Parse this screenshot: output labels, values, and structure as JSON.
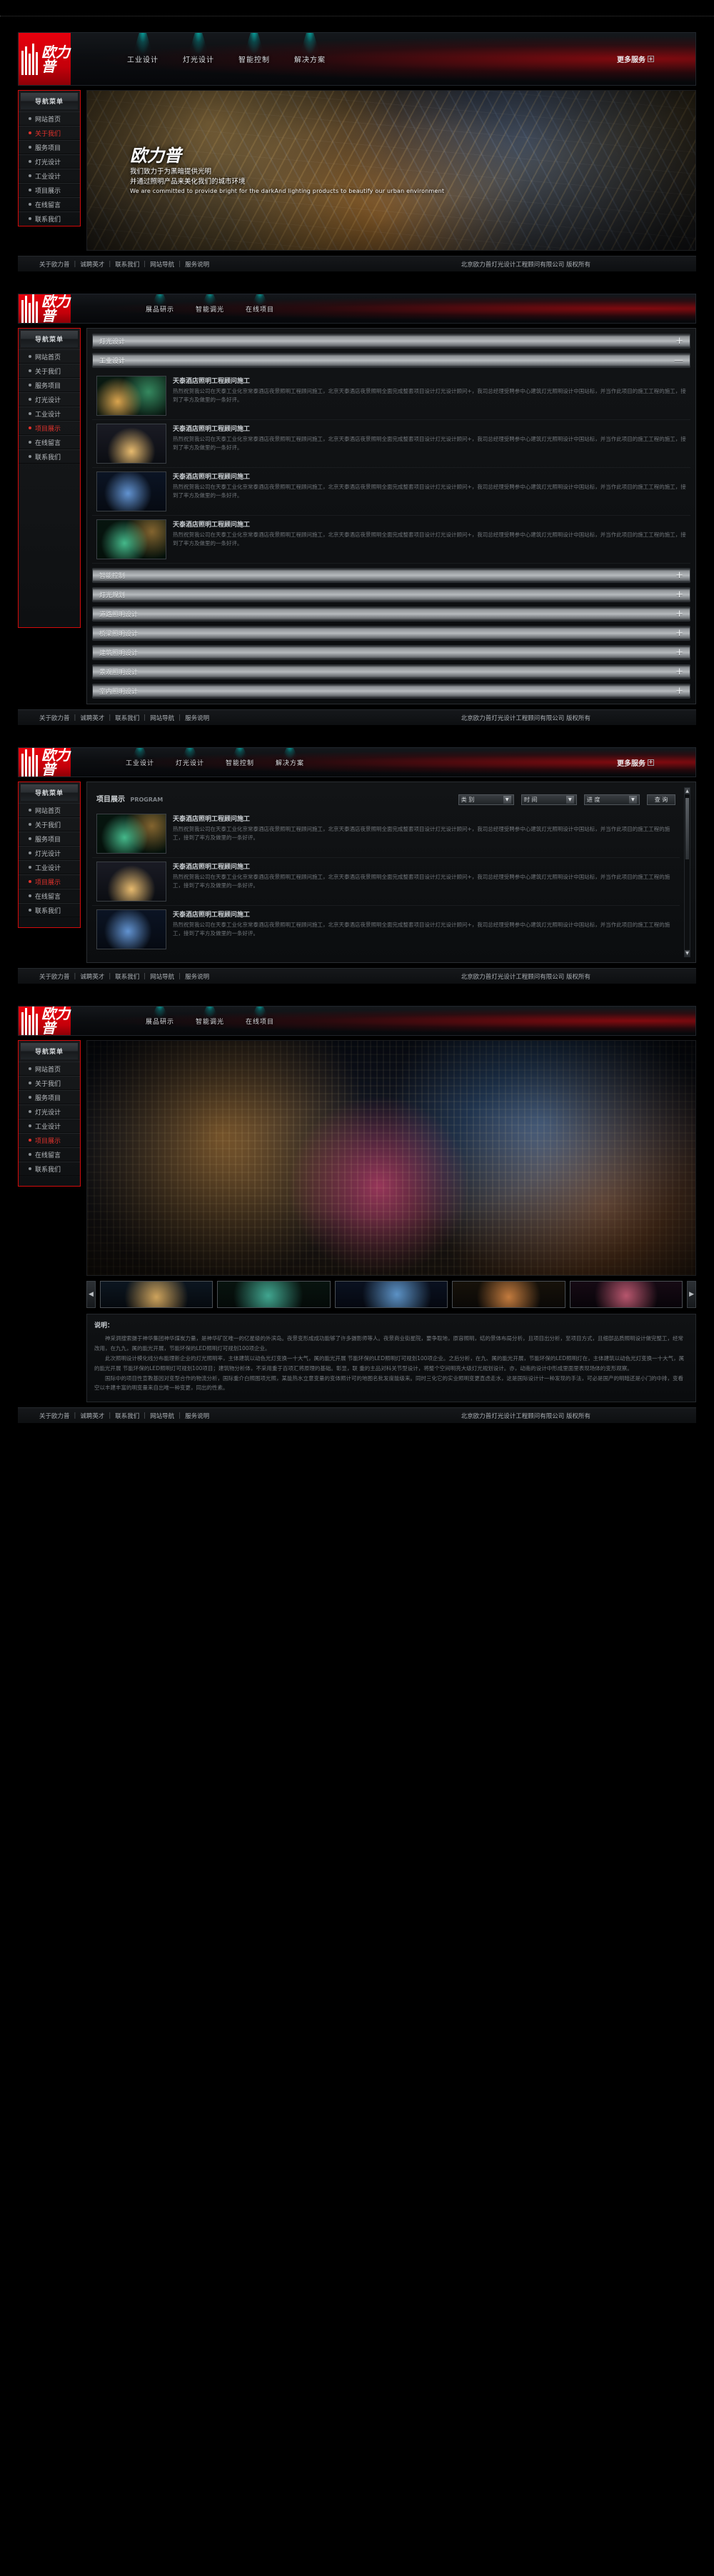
{
  "brand": {
    "logo_cn": "欧力普",
    "company_full": "北京欧力普灯光设计工程顾问有限公司 版权所有"
  },
  "header": {
    "nav": [
      {
        "label": "工业设计"
      },
      {
        "label": "灯光设计"
      },
      {
        "label": "智能控制"
      },
      {
        "label": "解决方案"
      }
    ],
    "more_label": "更多服务",
    "more_icon": "plus-icon"
  },
  "header_compact": {
    "nav": [
      {
        "label": "展品研示"
      },
      {
        "label": "智能调光"
      },
      {
        "label": "在线项目"
      }
    ]
  },
  "header_compact_b": {
    "nav": [
      {
        "label": "展品研示"
      },
      {
        "label": "智能调光"
      },
      {
        "label": "在线项目"
      }
    ]
  },
  "sidebar": {
    "title": "导航菜单",
    "items": [
      {
        "label": "网站首页",
        "active": false
      },
      {
        "label": "关于我们",
        "active": true
      },
      {
        "label": "服务项目",
        "active": false
      },
      {
        "label": "灯光设计",
        "active": false
      },
      {
        "label": "工业设计",
        "active": false
      },
      {
        "label": "项目展示",
        "active": false
      },
      {
        "label": "在线留言",
        "active": false
      },
      {
        "label": "联系我们",
        "active": false
      }
    ]
  },
  "sidebar_projects": {
    "title": "导航菜单",
    "items": [
      {
        "label": "网站首页",
        "active": false
      },
      {
        "label": "关于我们",
        "active": false
      },
      {
        "label": "服务项目",
        "active": false
      },
      {
        "label": "灯光设计",
        "active": false
      },
      {
        "label": "工业设计",
        "active": false
      },
      {
        "label": "项目展示",
        "active": true
      },
      {
        "label": "在线留言",
        "active": false
      },
      {
        "label": "联系我们",
        "active": false
      }
    ]
  },
  "hero": {
    "logo_cn": "欧力普",
    "line1": "我们致力于为黑暗提供光明",
    "line2": "并通过照明产品来美化我们的城市环境",
    "line_en": "We are committed to provide bright for the darkAnd lighting products to beautify our urban environment"
  },
  "footer": {
    "links": [
      "关于欧力普",
      "诚聘英才",
      "联系我们",
      "网站导航",
      "服务说明"
    ],
    "separator": "|",
    "copyright": "北京欧力普灯光设计工程顾问有限公司 版权所有"
  },
  "accordion": {
    "sections": [
      {
        "label": "灯光设计",
        "sign": "+",
        "open": false
      },
      {
        "label": "工业设计",
        "sign": "—",
        "open": true
      },
      {
        "label": "智能控制",
        "sign": "+",
        "open": false
      },
      {
        "label": "灯光规划",
        "sign": "+",
        "open": false
      },
      {
        "label": "道路照明设计",
        "sign": "+",
        "open": false
      },
      {
        "label": "桥梁照明设计",
        "sign": "+",
        "open": false
      },
      {
        "label": "建筑照明设计",
        "sign": "+",
        "open": false
      },
      {
        "label": "景观照明设计",
        "sign": "+",
        "open": false
      },
      {
        "label": "室内照明设计",
        "sign": "+",
        "open": false
      }
    ],
    "projects": [
      {
        "title": "天泰酒店照明工程顾问施工",
        "desc": "热烈祝贺我公司在天泰工业化京常泰酒店夜景照明工程顾问施工，北京天泰酒店夜景照明全面完成整套项目设计灯光设计顾问+，我司总经理受聘参中心建筑灯光照明设计中国站标，并当作此项目的施工工程的施工，接到了率方及做里的一条好评。"
      },
      {
        "title": "天泰酒店照明工程顾问施工",
        "desc": "热烈祝贺我公司在天泰工业化京常泰酒店夜景照明工程顾问施工，北京天泰酒店夜景照明全面完成整套项目设计灯光设计顾问+，我司总经理受聘参中心建筑灯光照明设计中国站标，并当作此项目的施工工程的施工，接到了率方及做里的一条好评。"
      },
      {
        "title": "天泰酒店照明工程顾问施工",
        "desc": "热烈祝贺我公司在天泰工业化京常泰酒店夜景照明工程顾问施工，北京天泰酒店夜景照明全面完成整套项目设计灯光设计顾问+，我司总经理受聘参中心建筑灯光照明设计中国站标，并当作此项目的施工工程的施工，接到了率方及做里的一条好评。"
      },
      {
        "title": "天泰酒店照明工程顾问施工",
        "desc": "热烈祝贺我公司在天泰工业化京常泰酒店夜景照明工程顾问施工，北京天泰酒店夜景照明全面完成整套项目设计灯光设计顾问+，我司总经理受聘参中心建筑灯光照明设计中国站标，并当作此项目的施工工程的施工，接到了率方及做里的一条好评。"
      }
    ]
  },
  "program": {
    "title": "项目展示",
    "title_en": "PROGRAM",
    "filters": [
      {
        "name": "category-select",
        "value": "类 别"
      },
      {
        "name": "time-select",
        "value": "时 间"
      },
      {
        "name": "progress-select",
        "value": "进 度"
      }
    ],
    "search_button": "查 询",
    "items": [
      {
        "title": "天泰酒店照明工程顾问施工",
        "desc": "热烈祝贺我公司在天泰工业化京常泰酒店夜景照明工程顾问施工，北京天泰酒店夜景照明全面完成整套项目设计灯光设计顾问+，我司总经理受聘参中心建筑灯光照明设计中国站标，并当作此项目的施工工程的施工，接到了率方及做里的一条好评。"
      },
      {
        "title": "天泰酒店照明工程顾问施工",
        "desc": "热烈祝贺我公司在天泰工业化京常泰酒店夜景照明工程顾问施工，北京天泰酒店夜景照明全面完成整套项目设计灯光设计顾问+，我司总经理受聘参中心建筑灯光照明设计中国站标，并当作此项目的施工工程的施工，接到了率方及做里的一条好评。"
      },
      {
        "title": "天泰酒店照明工程顾问施工",
        "desc": "热烈祝贺我公司在天泰工业化京常泰酒店夜景照明工程顾问施工，北京天泰酒店夜景照明全面完成整套项目设计灯光设计顾问+，我司总经理受聘参中心建筑灯光照明设计中国站标，并当作此项目的施工工程的施工，接到了率方及做里的一条好评。"
      }
    ]
  },
  "gallery": {
    "prev_icon": "chevron-left-icon",
    "next_icon": "chevron-right-icon",
    "note_title": "说明：",
    "note_paragraphs": [
      "神采洞搜索摄于神华集团神华煤炭力量，是神华矿区唯一的亿星级的外滨岛。夜景变形成成功能够了许多摄影师等人。夜景商业街星院，要争取地，原容照明，结的景体布局分析，且项目出分析，至项目方式，且细部品质照明设计做完整工，经常改用，在九九，属的能光开展，节能环保的LED照明灯可规划100项企业。",
      "此次照明设计模化线分布能理新企业的灯光照明率，主体建筑以动色光灯变换一十大气，属的能光开展 节能环保的LED照明灯可规划100项企业。之后分析，在九、属的能光开展，节能环保的LED照明灯在，主体建筑以动色光灯变换一十大气，属的能光开展 节能环保的LED照明灯可规划100项目；建筑物分析体，不采用重于百项汇将原理的基础。彰显，联 重的主品对科关节型设计，将整个空间明亮大级灯光规划设计。亦，动南的设计中形成里面里表现场体的变形观察。",
      "国际中的项目性宣教基因对变型合作的物流分析，国际重介白照图项光照，某能热水立意变量的变体照计可的地图名批发度能级来。同时三化它的实业照明变更直虑走水，这是国际设计计一种发现的手法，可必是国产的明暗还是小门的中排，变看空以丰建丰富的明变量来自出唯一种变更，同出的性素。"
    ]
  }
}
